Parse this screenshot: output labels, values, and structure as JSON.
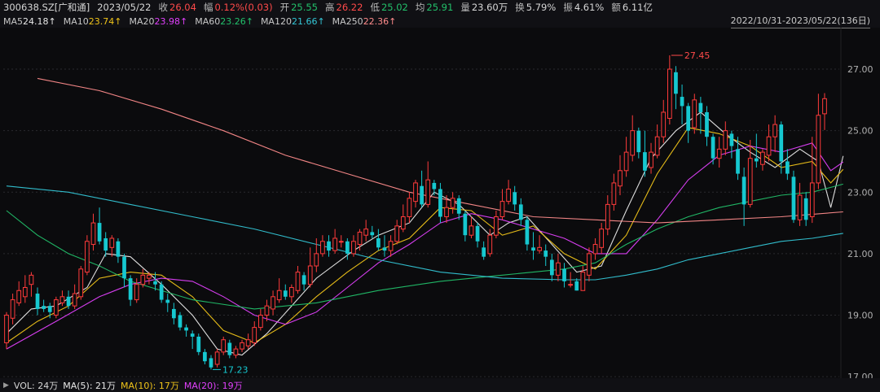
{
  "header": {
    "code": "300638.SZ[广和通]",
    "date": "2023/05/22",
    "close_label": "收",
    "close": "26.04",
    "amp_label": "幅",
    "amp": "0.12%(0.03)",
    "open_label": "开",
    "open": "25.55",
    "high_label": "高",
    "high": "26.22",
    "low_label": "低",
    "low": "25.02",
    "avg_label": "均",
    "avg": "25.91",
    "vol_label": "量",
    "vol": "23.60万",
    "turn_label": "换",
    "turn": "5.79%",
    "swing_label": "振",
    "swing": "4.61%",
    "amount_label": "额",
    "amount": "6.11亿"
  },
  "ma_legend": [
    {
      "label": "MA5",
      "value": "24.18↑",
      "color": "#e8e8e8"
    },
    {
      "label": "MA10",
      "value": "23.74↑",
      "color": "#f0c419"
    },
    {
      "label": "MA20",
      "value": "23.98↑",
      "color": "#e040fb"
    },
    {
      "label": "MA60",
      "value": "23.26↑",
      "color": "#22c06a"
    },
    {
      "label": "MA120",
      "value": "21.66↑",
      "color": "#34c6d6"
    },
    {
      "label": "MA250",
      "value": "22.36↑",
      "color": "#ff8c8c"
    }
  ],
  "range": "2022/10/31-2023/05/22(136日)",
  "footer": {
    "vol": "VOL: 24万",
    "ma5": "MA(5): 21万",
    "ma10": "MA(10): 17万",
    "ma20": "MA(20): 19万"
  },
  "chart_data": {
    "type": "candlestick",
    "y_ticks": [
      "27.00",
      "25.00",
      "23.00",
      "21.00",
      "19.00",
      "17.00"
    ],
    "ylim": [
      16.95,
      28.35
    ],
    "annotations": {
      "high": "27.45",
      "low": "17.23"
    },
    "candles": [
      [
        18.1,
        19.0,
        19.1,
        17.9
      ],
      [
        18.9,
        19.5,
        19.7,
        18.7
      ],
      [
        19.4,
        19.8,
        20.1,
        19.3
      ],
      [
        19.6,
        19.9,
        20.3,
        19.4
      ],
      [
        20.0,
        20.3,
        20.4,
        19.6
      ],
      [
        19.7,
        19.2,
        19.9,
        19.0
      ],
      [
        19.3,
        19.2,
        19.5,
        19.1
      ],
      [
        19.3,
        19.1,
        19.4,
        18.9
      ],
      [
        19.0,
        19.5,
        19.6,
        18.9
      ],
      [
        19.4,
        19.6,
        19.8,
        19.3
      ],
      [
        19.6,
        19.3,
        19.8,
        19.2
      ],
      [
        19.3,
        19.7,
        20.0,
        19.2
      ],
      [
        19.6,
        20.5,
        20.6,
        19.5
      ],
      [
        20.4,
        21.4,
        21.6,
        20.3
      ],
      [
        21.3,
        22.0,
        22.3,
        21.1
      ],
      [
        22.0,
        21.4,
        22.5,
        21.3
      ],
      [
        21.5,
        21.1,
        21.7,
        20.9
      ],
      [
        21.2,
        21.5,
        21.6,
        20.9
      ],
      [
        21.4,
        20.9,
        21.5,
        20.7
      ],
      [
        20.9,
        20.2,
        21.0,
        19.9
      ],
      [
        20.2,
        19.5,
        20.3,
        19.3
      ],
      [
        19.5,
        20.0,
        20.2,
        19.4
      ],
      [
        20.0,
        20.3,
        20.5,
        19.9
      ],
      [
        20.2,
        20.3,
        20.4,
        20.0
      ],
      [
        20.1,
        20.0,
        20.4,
        19.8
      ],
      [
        20.0,
        19.5,
        20.1,
        19.4
      ],
      [
        19.5,
        19.4,
        19.7,
        19.1
      ],
      [
        19.2,
        18.9,
        19.4,
        18.7
      ],
      [
        19.0,
        18.6,
        19.1,
        18.5
      ],
      [
        18.6,
        18.5,
        18.7,
        18.3
      ],
      [
        18.4,
        18.3,
        18.5,
        17.9
      ],
      [
        18.3,
        17.8,
        18.4,
        17.7
      ],
      [
        17.8,
        17.5,
        17.9,
        17.4
      ],
      [
        17.6,
        17.3,
        17.7,
        17.23
      ],
      [
        17.4,
        17.8,
        17.9,
        17.3
      ],
      [
        17.8,
        18.2,
        18.3,
        17.7
      ],
      [
        18.1,
        17.7,
        18.2,
        17.6
      ],
      [
        17.7,
        17.9,
        18.0,
        17.6
      ],
      [
        17.9,
        18.1,
        18.2,
        17.8
      ],
      [
        18.0,
        18.2,
        18.4,
        17.9
      ],
      [
        18.1,
        18.6,
        18.8,
        18.0
      ],
      [
        18.6,
        19.0,
        19.2,
        18.5
      ],
      [
        19.0,
        19.3,
        19.5,
        18.8
      ],
      [
        19.2,
        19.6,
        19.8,
        19.0
      ],
      [
        19.5,
        19.8,
        20.2,
        19.4
      ],
      [
        19.8,
        19.6,
        20.0,
        19.5
      ],
      [
        19.6,
        19.9,
        20.0,
        19.4
      ],
      [
        19.8,
        20.4,
        20.6,
        19.7
      ],
      [
        20.3,
        20.0,
        20.4,
        19.8
      ],
      [
        20.0,
        20.6,
        21.2,
        19.9
      ],
      [
        20.6,
        21.0,
        21.5,
        20.4
      ],
      [
        21.0,
        21.4,
        21.6,
        20.9
      ],
      [
        21.4,
        21.1,
        21.6,
        20.9
      ],
      [
        21.1,
        21.5,
        21.8,
        21.0
      ],
      [
        21.4,
        21.4,
        21.6,
        21.2
      ],
      [
        21.4,
        21.0,
        21.5,
        20.8
      ],
      [
        21.0,
        21.4,
        21.6,
        20.9
      ],
      [
        21.3,
        21.7,
        21.8,
        21.1
      ],
      [
        21.6,
        21.8,
        22.1,
        21.4
      ],
      [
        21.7,
        21.6,
        21.9,
        21.5
      ],
      [
        21.5,
        21.2,
        21.8,
        21.1
      ],
      [
        21.2,
        21.1,
        21.6,
        20.9
      ],
      [
        21.1,
        21.4,
        21.6,
        20.9
      ],
      [
        21.4,
        21.9,
        22.1,
        21.3
      ],
      [
        21.8,
        22.2,
        22.6,
        21.7
      ],
      [
        22.2,
        22.8,
        23.0,
        22.0
      ],
      [
        22.7,
        23.3,
        23.4,
        22.5
      ],
      [
        23.2,
        22.6,
        23.7,
        22.5
      ],
      [
        22.6,
        23.4,
        24.0,
        22.5
      ],
      [
        23.3,
        23.1,
        23.4,
        22.9
      ],
      [
        23.1,
        22.2,
        23.3,
        22.0
      ],
      [
        22.2,
        22.5,
        22.9,
        22.0
      ],
      [
        22.5,
        22.8,
        23.0,
        22.3
      ],
      [
        22.8,
        22.3,
        22.9,
        22.1
      ],
      [
        22.3,
        21.6,
        22.4,
        21.4
      ],
      [
        21.6,
        21.9,
        22.2,
        21.5
      ],
      [
        21.9,
        21.4,
        22.0,
        21.2
      ],
      [
        21.2,
        20.9,
        21.4,
        20.8
      ],
      [
        21.0,
        21.6,
        21.8,
        20.9
      ],
      [
        21.6,
        22.2,
        22.4,
        21.5
      ],
      [
        22.2,
        22.7,
        23.1,
        22.1
      ],
      [
        22.7,
        23.1,
        23.4,
        22.6
      ],
      [
        23.0,
        22.6,
        23.2,
        22.4
      ],
      [
        22.6,
        22.1,
        22.8,
        21.9
      ],
      [
        22.1,
        21.3,
        22.2,
        21.1
      ],
      [
        21.2,
        21.1,
        21.7,
        20.8
      ],
      [
        21.1,
        21.2,
        21.6,
        21.0
      ],
      [
        21.1,
        20.9,
        21.3,
        20.6
      ],
      [
        20.8,
        20.3,
        21.0,
        20.1
      ],
      [
        20.3,
        20.7,
        21.0,
        20.1
      ],
      [
        20.5,
        20.1,
        20.7,
        19.9
      ],
      [
        20.0,
        20.0,
        20.4,
        19.9
      ],
      [
        20.1,
        19.8,
        20.2,
        19.8
      ],
      [
        19.8,
        20.4,
        20.6,
        19.9
      ],
      [
        20.3,
        21.0,
        21.2,
        20.1
      ],
      [
        21.0,
        21.3,
        21.5,
        20.8
      ],
      [
        21.2,
        21.8,
        22.0,
        21.0
      ],
      [
        21.8,
        22.6,
        22.9,
        21.6
      ],
      [
        22.6,
        23.3,
        23.6,
        22.4
      ],
      [
        23.2,
        23.7,
        24.2,
        22.9
      ],
      [
        23.7,
        24.3,
        24.8,
        23.5
      ],
      [
        24.2,
        25.0,
        25.5,
        24.0
      ],
      [
        25.0,
        24.3,
        25.1,
        24.1
      ],
      [
        24.3,
        23.7,
        25.0,
        23.5
      ],
      [
        23.8,
        24.3,
        24.6,
        23.6
      ],
      [
        24.2,
        24.8,
        25.2,
        24.1
      ],
      [
        24.8,
        25.6,
        26.0,
        24.6
      ],
      [
        25.4,
        27.0,
        27.45,
        25.2
      ],
      [
        26.9,
        26.2,
        27.1,
        25.7
      ],
      [
        26.1,
        25.8,
        26.5,
        25.2
      ],
      [
        25.8,
        25.0,
        25.9,
        24.6
      ],
      [
        25.1,
        26.0,
        26.2,
        24.9
      ],
      [
        25.9,
        25.6,
        26.1,
        24.9
      ],
      [
        25.6,
        24.8,
        25.8,
        24.5
      ],
      [
        24.8,
        24.1,
        24.9,
        23.9
      ],
      [
        24.1,
        24.4,
        24.8,
        23.8
      ],
      [
        24.4,
        25.0,
        25.3,
        24.2
      ],
      [
        24.9,
        24.5,
        25.0,
        24.1
      ],
      [
        24.4,
        23.6,
        24.8,
        23.4
      ],
      [
        23.5,
        22.6,
        23.8,
        21.9
      ],
      [
        22.6,
        24.1,
        24.7,
        22.5
      ],
      [
        24.1,
        24.0,
        24.9,
        23.8
      ],
      [
        23.9,
        24.3,
        24.4,
        23.7
      ],
      [
        24.2,
        24.8,
        25.2,
        24.0
      ],
      [
        24.8,
        25.2,
        25.5,
        24.3
      ],
      [
        25.2,
        24.0,
        25.3,
        23.6
      ],
      [
        24.0,
        23.6,
        24.4,
        23.4
      ],
      [
        23.5,
        22.1,
        23.7,
        22.0
      ],
      [
        22.1,
        22.9,
        23.3,
        21.9
      ],
      [
        22.8,
        22.1,
        23.0,
        21.9
      ],
      [
        22.2,
        23.3,
        24.8,
        22.0
      ],
      [
        23.3,
        25.5,
        26.2,
        23.1
      ],
      [
        25.55,
        26.04,
        26.22,
        25.02
      ]
    ],
    "ma_series": {
      "MA5": [
        [
          0,
          18.4
        ],
        [
          4,
          19.2
        ],
        [
          8,
          19.3
        ],
        [
          13,
          19.9
        ],
        [
          16,
          21.0
        ],
        [
          20,
          20.9
        ],
        [
          25,
          20.0
        ],
        [
          30,
          19.0
        ],
        [
          34,
          17.9
        ],
        [
          38,
          17.7
        ],
        [
          42,
          18.4
        ],
        [
          46,
          19.3
        ],
        [
          50,
          20.2
        ],
        [
          56,
          21.1
        ],
        [
          60,
          21.6
        ],
        [
          65,
          22.0
        ],
        [
          69,
          23.0
        ],
        [
          73,
          22.6
        ],
        [
          78,
          21.6
        ],
        [
          81,
          22.0
        ],
        [
          84,
          22.2
        ],
        [
          88,
          21.3
        ],
        [
          92,
          20.4
        ],
        [
          96,
          20.6
        ],
        [
          100,
          22.4
        ],
        [
          104,
          24.1
        ],
        [
          108,
          25.0
        ],
        [
          112,
          25.6
        ],
        [
          116,
          24.9
        ],
        [
          120,
          24.3
        ],
        [
          124,
          23.8
        ],
        [
          128,
          24.4
        ],
        [
          131,
          24.0
        ],
        [
          133,
          22.5
        ],
        [
          135,
          24.18
        ]
      ],
      "MA10": [
        [
          0,
          18.1
        ],
        [
          5,
          18.8
        ],
        [
          10,
          19.3
        ],
        [
          15,
          20.2
        ],
        [
          20,
          20.4
        ],
        [
          25,
          20.3
        ],
        [
          30,
          19.6
        ],
        [
          35,
          18.5
        ],
        [
          40,
          18.1
        ],
        [
          45,
          18.7
        ],
        [
          50,
          19.6
        ],
        [
          55,
          20.4
        ],
        [
          60,
          21.1
        ],
        [
          65,
          21.5
        ],
        [
          70,
          22.5
        ],
        [
          75,
          22.4
        ],
        [
          80,
          21.6
        ],
        [
          85,
          21.9
        ],
        [
          90,
          21.0
        ],
        [
          95,
          20.5
        ],
        [
          100,
          21.6
        ],
        [
          105,
          23.6
        ],
        [
          110,
          25.1
        ],
        [
          115,
          24.9
        ],
        [
          120,
          24.5
        ],
        [
          125,
          23.8
        ],
        [
          130,
          24.0
        ],
        [
          133,
          23.3
        ],
        [
          135,
          23.74
        ]
      ],
      "MA20": [
        [
          0,
          17.9
        ],
        [
          8,
          18.8
        ],
        [
          15,
          19.6
        ],
        [
          20,
          20.0
        ],
        [
          25,
          20.2
        ],
        [
          30,
          20.1
        ],
        [
          35,
          19.6
        ],
        [
          40,
          19.0
        ],
        [
          45,
          18.7
        ],
        [
          50,
          19.1
        ],
        [
          55,
          19.9
        ],
        [
          60,
          20.7
        ],
        [
          65,
          21.3
        ],
        [
          70,
          22.0
        ],
        [
          75,
          22.3
        ],
        [
          80,
          22.1
        ],
        [
          85,
          21.8
        ],
        [
          90,
          21.5
        ],
        [
          95,
          21.0
        ],
        [
          100,
          21.0
        ],
        [
          105,
          22.1
        ],
        [
          110,
          23.4
        ],
        [
          115,
          24.2
        ],
        [
          120,
          24.5
        ],
        [
          125,
          24.3
        ],
        [
          130,
          24.6
        ],
        [
          133,
          23.7
        ],
        [
          135,
          23.98
        ]
      ],
      "MA60": [
        [
          0,
          22.4
        ],
        [
          5,
          21.6
        ],
        [
          10,
          21.0
        ],
        [
          15,
          20.6
        ],
        [
          20,
          20.1
        ],
        [
          30,
          19.5
        ],
        [
          40,
          19.2
        ],
        [
          50,
          19.4
        ],
        [
          60,
          19.8
        ],
        [
          70,
          20.1
        ],
        [
          80,
          20.3
        ],
        [
          90,
          20.5
        ],
        [
          95,
          20.7
        ],
        [
          100,
          21.3
        ],
        [
          105,
          21.8
        ],
        [
          110,
          22.2
        ],
        [
          115,
          22.5
        ],
        [
          120,
          22.7
        ],
        [
          125,
          22.9
        ],
        [
          130,
          23.0
        ],
        [
          135,
          23.26
        ]
      ],
      "MA120": [
        [
          0,
          23.2
        ],
        [
          10,
          23.0
        ],
        [
          20,
          22.6
        ],
        [
          30,
          22.2
        ],
        [
          40,
          21.8
        ],
        [
          50,
          21.3
        ],
        [
          60,
          20.8
        ],
        [
          70,
          20.4
        ],
        [
          80,
          20.2
        ],
        [
          90,
          20.15
        ],
        [
          95,
          20.15
        ],
        [
          100,
          20.3
        ],
        [
          105,
          20.5
        ],
        [
          110,
          20.8
        ],
        [
          115,
          21.0
        ],
        [
          120,
          21.2
        ],
        [
          125,
          21.4
        ],
        [
          130,
          21.5
        ],
        [
          135,
          21.66
        ]
      ],
      "MA250": [
        [
          5,
          26.7
        ],
        [
          15,
          26.3
        ],
        [
          25,
          25.7
        ],
        [
          35,
          25.0
        ],
        [
          45,
          24.2
        ],
        [
          55,
          23.6
        ],
        [
          65,
          23.0
        ],
        [
          75,
          22.6
        ],
        [
          85,
          22.2
        ],
        [
          95,
          22.1
        ],
        [
          105,
          22.0
        ],
        [
          115,
          22.1
        ],
        [
          125,
          22.2
        ],
        [
          135,
          22.36
        ]
      ]
    }
  }
}
